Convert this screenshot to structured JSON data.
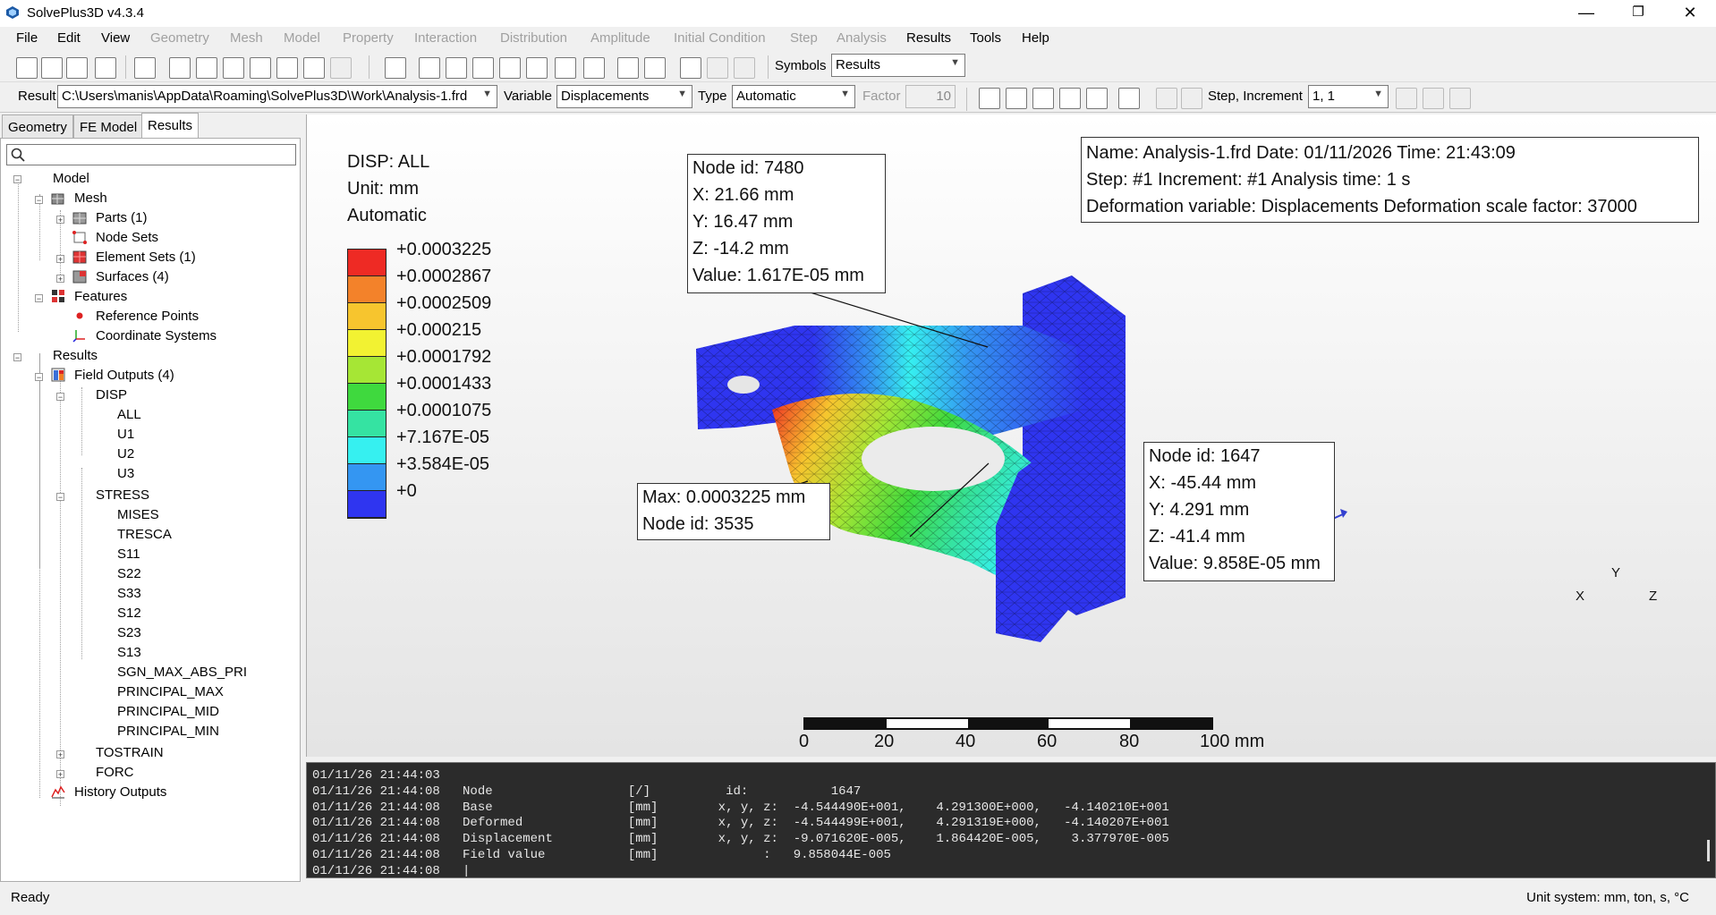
{
  "app": {
    "title": "SolvePlus3D v4.3.4",
    "controls": [
      "—",
      "❐",
      "✕"
    ]
  },
  "menu": [
    {
      "label": "File",
      "enabled": true
    },
    {
      "label": "Edit",
      "enabled": true
    },
    {
      "label": "View",
      "enabled": true
    },
    {
      "label": "Geometry",
      "enabled": false
    },
    {
      "label": "Mesh",
      "enabled": false
    },
    {
      "label": "Model",
      "enabled": false
    },
    {
      "label": "Property",
      "enabled": false
    },
    {
      "label": "Interaction",
      "enabled": false
    },
    {
      "label": "Distribution",
      "enabled": false
    },
    {
      "label": "Amplitude",
      "enabled": false
    },
    {
      "label": "Initial Condition",
      "enabled": false
    },
    {
      "label": "Step",
      "enabled": false
    },
    {
      "label": "Analysis",
      "enabled": false
    },
    {
      "label": "Results",
      "enabled": true
    },
    {
      "label": "Tools",
      "enabled": true
    },
    {
      "label": "Help",
      "enabled": true
    }
  ],
  "toolbar1": {
    "symbols_label": "Symbols",
    "symbols_value": "Results"
  },
  "toolbar2": {
    "result_label": "Result",
    "result_value": "C:\\Users\\manis\\AppData\\Roaming\\SolvePlus3D\\Work\\Analysis-1.frd",
    "variable_label": "Variable",
    "variable_value": "Displacements",
    "type_label": "Type",
    "type_value": "Automatic",
    "factor_label": "Factor",
    "factor_value": "10",
    "step_label": "Step, Increment",
    "step_value": "1, 1"
  },
  "panel": {
    "tabs": [
      "Geometry",
      "FE Model",
      "Results"
    ],
    "active_tab": "Results",
    "search_placeholder": ""
  },
  "tree": {
    "model": "Model",
    "mesh": "Mesh",
    "parts": "Parts (1)",
    "node_sets": "Node Sets",
    "element_sets": "Element Sets (1)",
    "surfaces": "Surfaces (4)",
    "features": "Features",
    "reference_points": "Reference Points",
    "coordinate_systems": "Coordinate Systems",
    "results": "Results",
    "field_outputs": "Field Outputs (4)",
    "disp": "DISP",
    "disp_items": [
      "ALL",
      "U1",
      "U2",
      "U3"
    ],
    "stress": "STRESS",
    "stress_items": [
      "MISES",
      "TRESCA",
      "S11",
      "S22",
      "S33",
      "S12",
      "S23",
      "S13",
      "SGN_MAX_ABS_PRI",
      "PRINCIPAL_MAX",
      "PRINCIPAL_MID",
      "PRINCIPAL_MIN"
    ],
    "tostrain": "TOSTRAIN",
    "forc": "FORC",
    "history_outputs": "History Outputs"
  },
  "viewport": {
    "legend_title": "DISP: ALL",
    "legend_unit": "Unit: mm",
    "legend_mode": "Automatic",
    "legend_values": [
      "+0.0003225",
      "+0.0002867",
      "+0.0002509",
      "+0.000215",
      "+0.0001792",
      "+0.0001433",
      "+0.0001075",
      "+7.167E-05",
      "+3.584E-05",
      "+0"
    ],
    "legend_colors": [
      "#ee2a24",
      "#f3822a",
      "#f7c52e",
      "#f2f232",
      "#a6e635",
      "#3fd93e",
      "#35e3a2",
      "#36f0f0",
      "#3496f2",
      "#2f35f0"
    ],
    "info": {
      "line1": "Name: Analysis-1.frd   Date: 01/11/2026   Time: 21:43:09",
      "line2": "Step: #1   Increment: #1   Analysis time: 1 s",
      "line3": "Deformation variable: Displacements   Deformation scale factor: 37000"
    },
    "probe1": [
      "Node id: 7480",
      "X: 21.66 mm",
      "Y: 16.47 mm",
      "Z: -14.2 mm",
      "Value: 1.617E-05 mm"
    ],
    "probe2": [
      "Node id: 1647",
      "X: -45.44 mm",
      "Y: 4.291 mm",
      "Z: -41.4 mm",
      "Value: 9.858E-05 mm"
    ],
    "max_box": [
      "Max: 0.0003225 mm",
      "Node id: 3535"
    ],
    "scale_labels": [
      "0",
      "20",
      "40",
      "60",
      "80",
      "100 mm"
    ],
    "axis_labels": {
      "x": "X",
      "y": "Y",
      "z": "Z"
    }
  },
  "console": {
    "lines": [
      "01/11/26 21:44:03",
      "01/11/26 21:44:08   Node                  [/]          id:           1647",
      "01/11/26 21:44:08   Base                  [mm]        x, y, z:  -4.544490E+001,    4.291300E+000,   -4.140210E+001",
      "01/11/26 21:44:08   Deformed              [mm]        x, y, z:  -4.544499E+001,    4.291319E+000,   -4.140207E+001",
      "01/11/26 21:44:08   Displacement          [mm]        x, y, z:  -9.071620E-005,    1.864420E-005,    3.377970E-005",
      "01/11/26 21:44:08   Field value           [mm]              :   9.858044E-005",
      "01/11/26 21:44:08   |"
    ]
  },
  "status": {
    "left": "Ready",
    "right": "Unit system: mm, ton, s, °C"
  }
}
